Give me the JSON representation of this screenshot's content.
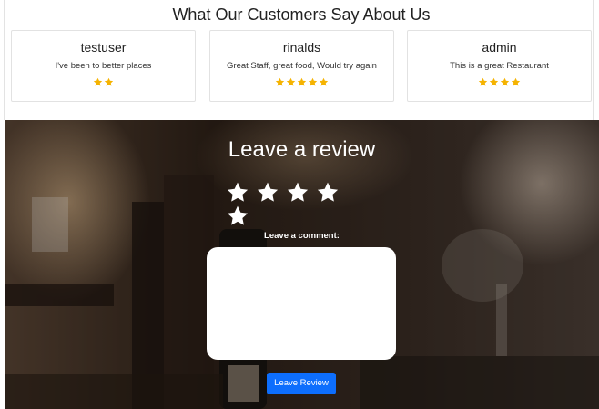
{
  "testimonials": {
    "title": "What Our Customers Say About Us",
    "reviews": [
      {
        "user": "testuser",
        "comment": "I've been to better places",
        "rating": 2
      },
      {
        "user": "rinalds",
        "comment": "Great Staff, great food, Would try again",
        "rating": 5
      },
      {
        "user": "admin",
        "comment": "This is a great Restaurant",
        "rating": 4
      }
    ]
  },
  "review_form": {
    "title": "Leave a review",
    "rating_selected": 0,
    "rating_max": 5,
    "comment_label": "Leave a comment:",
    "comment_value": "",
    "submit_label": "Leave Review"
  },
  "colors": {
    "star_filled": "#f5b301",
    "star_empty": "#ffffff",
    "button": "#0d6efd"
  }
}
